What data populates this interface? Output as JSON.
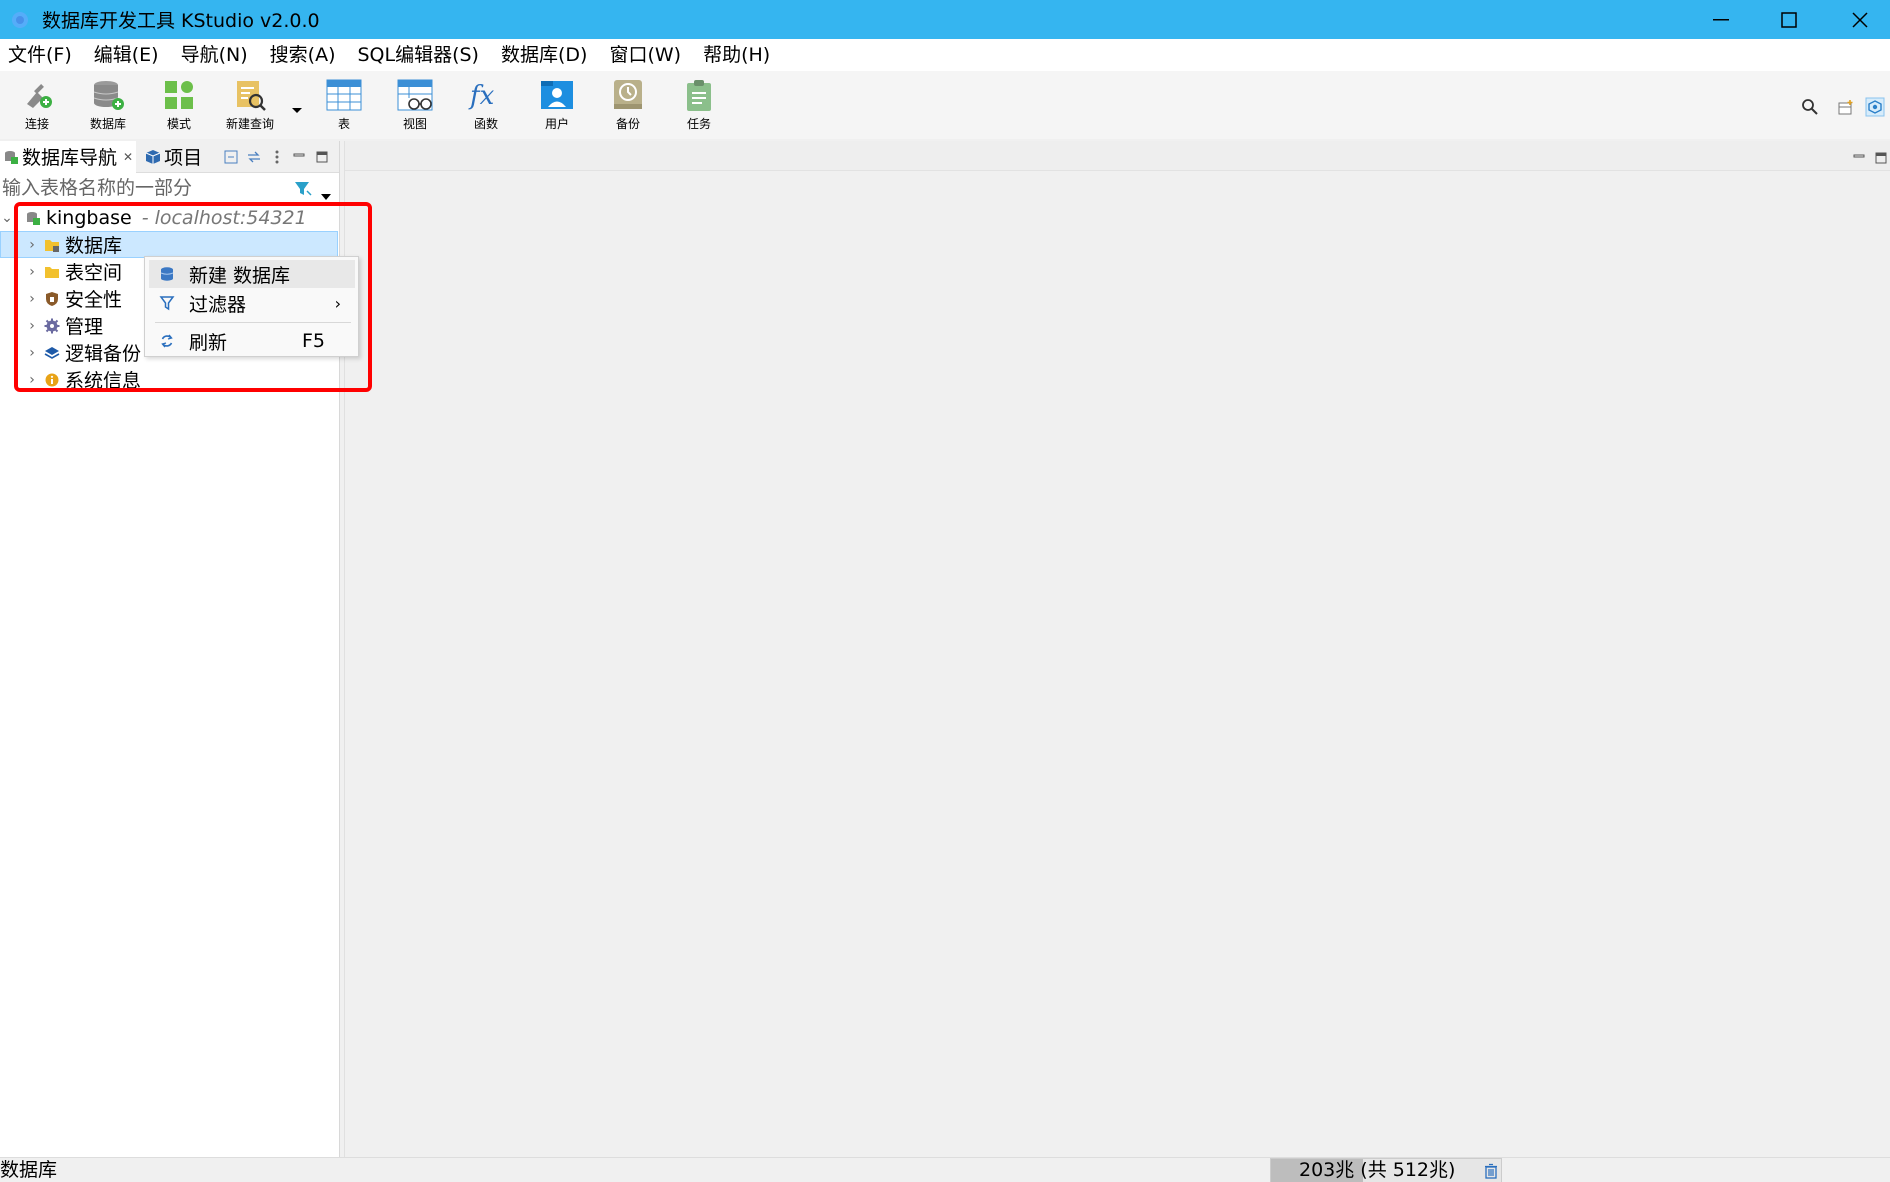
{
  "window": {
    "title": "数据库开发工具 KStudio v2.0.0",
    "controls": [
      "minimize",
      "maximize",
      "close"
    ]
  },
  "menubar": {
    "items": [
      "文件(F)",
      "编辑(E)",
      "导航(N)",
      "搜索(A)",
      "SQL编辑器(S)",
      "数据库(D)",
      "窗口(W)",
      "帮助(H)"
    ]
  },
  "toolbar": {
    "buttons": [
      {
        "label": "连接",
        "icon": "plug-icon"
      },
      {
        "label": "数据库",
        "icon": "database-add-icon"
      },
      {
        "label": "模式",
        "icon": "schema-icon"
      },
      {
        "label": "新建查询",
        "icon": "new-query-icon"
      },
      {
        "label": "表",
        "icon": "table-icon"
      },
      {
        "label": "视图",
        "icon": "view-icon"
      },
      {
        "label": "函数",
        "icon": "function-icon"
      },
      {
        "label": "用户",
        "icon": "user-icon"
      },
      {
        "label": "备份",
        "icon": "backup-icon"
      },
      {
        "label": "任务",
        "icon": "task-icon"
      }
    ]
  },
  "navigator": {
    "tabs": [
      {
        "label": "数据库导航",
        "active": true
      },
      {
        "label": "项目",
        "active": false
      }
    ],
    "filter_placeholder": "输入表格名称的一部分",
    "tree": {
      "root": {
        "label": "kingbase",
        "host": "- localhost:54321"
      },
      "children": [
        {
          "label": "数据库",
          "icon": "folder-db-icon",
          "selected": true
        },
        {
          "label": "表空间",
          "icon": "folder-icon"
        },
        {
          "label": "安全性",
          "icon": "shield-icon"
        },
        {
          "label": "管理",
          "icon": "gear-icon"
        },
        {
          "label": "逻辑备份",
          "icon": "layers-icon"
        },
        {
          "label": "系统信息",
          "icon": "info-icon"
        }
      ]
    }
  },
  "context_menu": {
    "items": [
      {
        "label": "新建 数据库",
        "icon": "database-icon"
      },
      {
        "label": "过滤器",
        "icon": "filter-icon",
        "submenu": true
      },
      {
        "label": "刷新",
        "icon": "refresh-icon",
        "shortcut": "F5"
      }
    ]
  },
  "statusbar": {
    "left": "数据库",
    "memory": "203兆 (共 512兆)",
    "memory_used_fraction": 0.4
  },
  "colors": {
    "titlebar": "#35b5f0",
    "selection": "#cce8ff",
    "highlight_box": "#ff0000"
  }
}
